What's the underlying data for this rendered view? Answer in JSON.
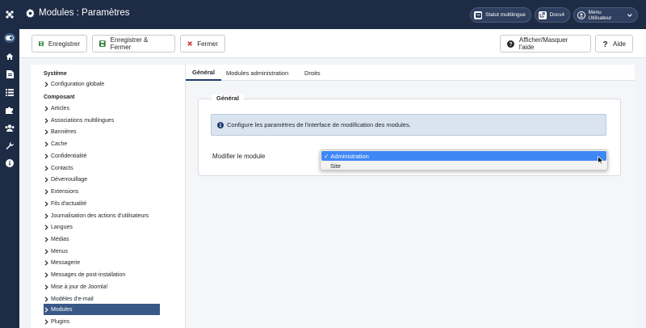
{
  "header": {
    "title": "Modules : Paramètres",
    "buttons": [
      {
        "label": "Statut multilingue",
        "icon": "language-icon"
      },
      {
        "label": "Docs4",
        "icon": "external-link-icon"
      },
      {
        "label": "Menu Utilisateur",
        "icon": "user-icon"
      }
    ]
  },
  "toolbar": {
    "save_label": "Enregistrer",
    "save_close_label": "Enregistrer & Fermer",
    "close_label": "Fermer",
    "toggle_help_label": "Afficher/Masquer l'aide",
    "help_label": "Aide"
  },
  "sidebar": {
    "system_heading": "Système",
    "system_items": [
      "Configuration globale"
    ],
    "component_heading": "Composant",
    "component_items": [
      "Articles",
      "Associations multilingues",
      "Bannières",
      "Cache",
      "Confidentialité",
      "Contacts",
      "Déverrouillage",
      "Extensions",
      "Fils d'actualité",
      "Journalisation des actions d'utilisateurs",
      "Langues",
      "Médias",
      "Menus",
      "Messagerie",
      "Messages de post-installation",
      "Mise à jour de Joomla!",
      "Modèles d'e-mail",
      "Modules",
      "Plugins"
    ],
    "active_item": "Modules"
  },
  "tabs": [
    "Général",
    "Modules administration",
    "Droits"
  ],
  "panel": {
    "legend": "Général",
    "info_text": "Configure les paramètres de l'interface de modification des modules.",
    "field_label": "Modifier le module",
    "options": [
      "Administration",
      "Site"
    ],
    "selected": "Administration"
  },
  "colors": {
    "header_bg": "#1d2b45",
    "active_item_bg": "#3a5885",
    "save_icon": "#2f7d32",
    "close_icon": "#c52827",
    "selected_option": "#3f87f5"
  }
}
